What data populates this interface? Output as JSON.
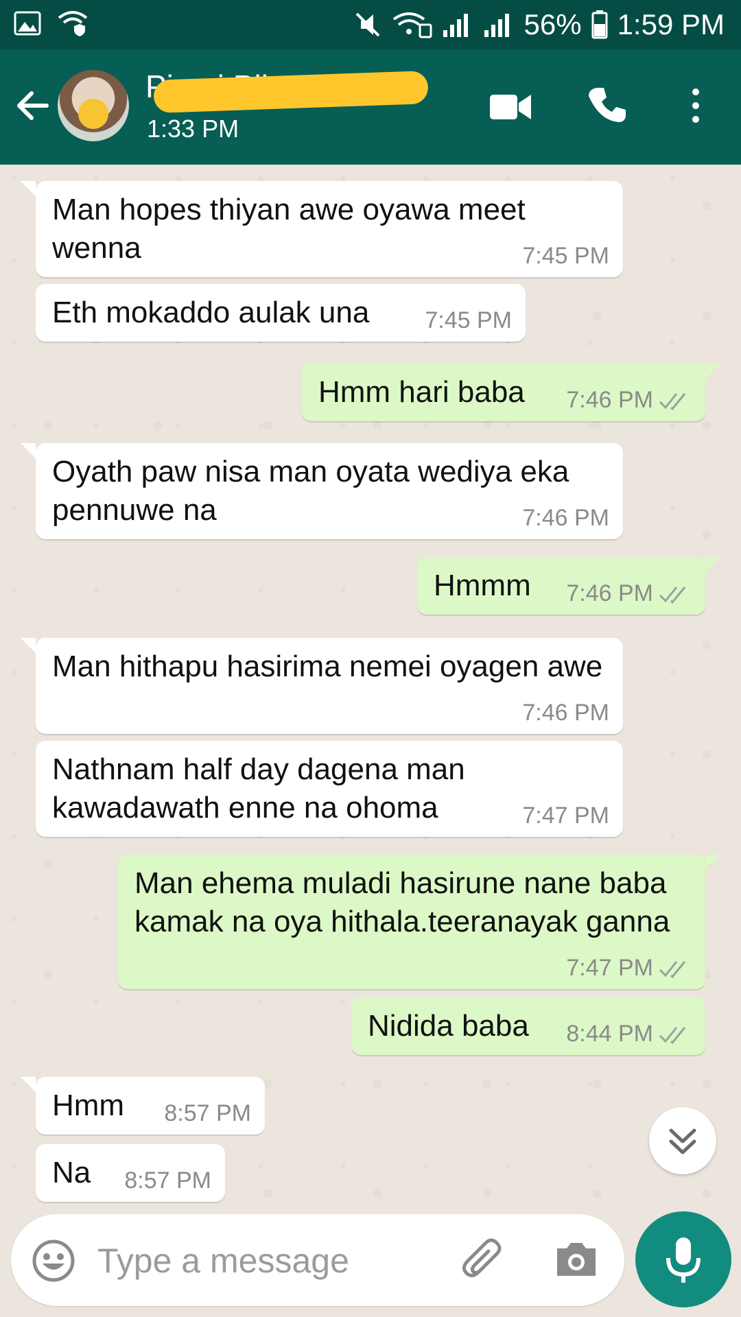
{
  "status_bar": {
    "battery": "56%",
    "time": "1:59 PM"
  },
  "header": {
    "contact_name": "Piumi Pil...",
    "last_seen": "1:33 PM"
  },
  "messages": [
    {
      "dir": "in",
      "text": "Man hopes thiyan awe oyawa meet wenna",
      "time": "7:45 PM"
    },
    {
      "dir": "in",
      "text": "Eth mokaddo aulak una",
      "time": "7:45 PM"
    },
    {
      "dir": "out",
      "text": "Hmm hari baba",
      "time": "7:46 PM"
    },
    {
      "dir": "in",
      "text": "Oyath paw nisa man oyata wediya eka pennuwe na",
      "time": "7:46 PM"
    },
    {
      "dir": "out",
      "text": "Hmmm",
      "time": "7:46 PM"
    },
    {
      "dir": "in",
      "text": "Man hithapu hasirima nemei oyagen awe",
      "time": "7:46 PM"
    },
    {
      "dir": "in",
      "text": "Nathnam half day dagena man kawadawath enne na ohoma",
      "time": "7:47 PM"
    },
    {
      "dir": "out",
      "text": "Man ehema muladi hasirune nane baba kamak na oya hithala.teeranayak ganna",
      "time": "7:47 PM"
    },
    {
      "dir": "out",
      "text": "Nidida baba",
      "time": "8:44 PM"
    },
    {
      "dir": "in",
      "text": "Hmm",
      "time": "8:57 PM"
    },
    {
      "dir": "in",
      "text": "Na",
      "time": "8:57 PM"
    }
  ],
  "composer": {
    "placeholder": "Type a message"
  },
  "colors": {
    "header": "#075e54",
    "status_bar": "#054d44",
    "outgoing_bubble": "#dcf8c6",
    "incoming_bubble": "#ffffff",
    "mic_button": "#128c7e",
    "read_ticks": "#9aa0a0"
  },
  "icons": {
    "back": "arrow-left-icon",
    "video": "video-camera-icon",
    "call": "phone-icon",
    "menu": "more-vert-icon",
    "emoji": "smiley-icon",
    "attach": "paperclip-icon",
    "camera": "camera-icon",
    "mic": "microphone-icon",
    "scroll": "double-chevron-down-icon"
  }
}
